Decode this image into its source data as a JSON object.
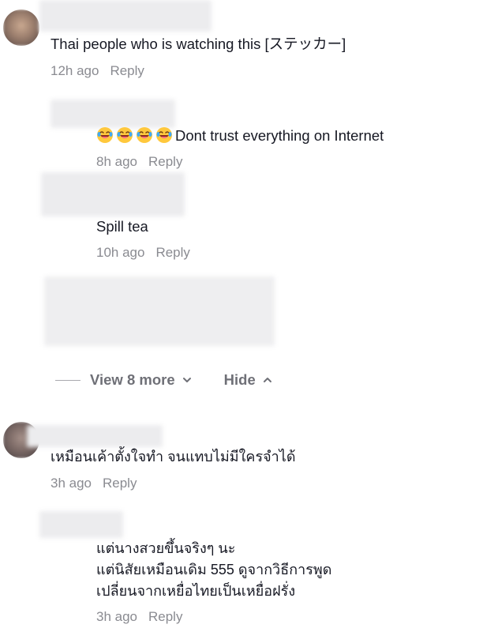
{
  "comments": [
    {
      "text": "Thai people who is watching this [ステッカー]",
      "time": "12h ago",
      "reply": "Reply"
    },
    {
      "emoji_count": 4,
      "emoji_icon": "laughing-crying-emoji-icon",
      "text": "Dont trust everything on Internet",
      "time": "8h ago",
      "reply": "Reply"
    },
    {
      "text": "Spill tea",
      "time": "10h ago",
      "reply": "Reply"
    },
    {
      "text": "เหมือนเค้าตั้งใจทำ จนแทบไม่มีใครจำได้",
      "time": "3h ago",
      "reply": "Reply"
    },
    {
      "lines": [
        "แต่นางสวยขึ้นจริงๆ นะ",
        "แต่นิสัยเหมือนเดิม 555 ดูจากวิธีการพูด",
        "เปลี่ยนจากเหยื่อไทยเป็นเหยื่อฝรั่ง"
      ],
      "time": "3h ago",
      "reply": "Reply"
    }
  ],
  "thread_controls": {
    "view_more": "View 8 more",
    "hide": "Hide"
  },
  "colors": {
    "text": "#161823",
    "meta": "#8a8b91",
    "control": "#6f7077"
  }
}
